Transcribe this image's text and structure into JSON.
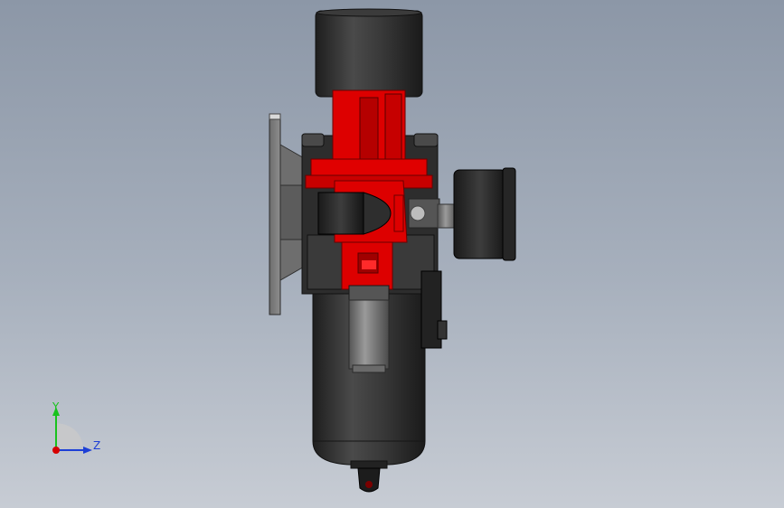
{
  "viewport": {
    "background": "#9aa4b2",
    "model_colors": {
      "body": "#2b2b2b",
      "section": "#dd0000",
      "metal": "#8a8a8a",
      "flange": "#7a7a7a"
    }
  },
  "triad": {
    "y_label": "Y",
    "z_label": "Z",
    "y_color": "#19c21e",
    "z_color": "#1d3fd6",
    "x_color": "#d60000"
  }
}
